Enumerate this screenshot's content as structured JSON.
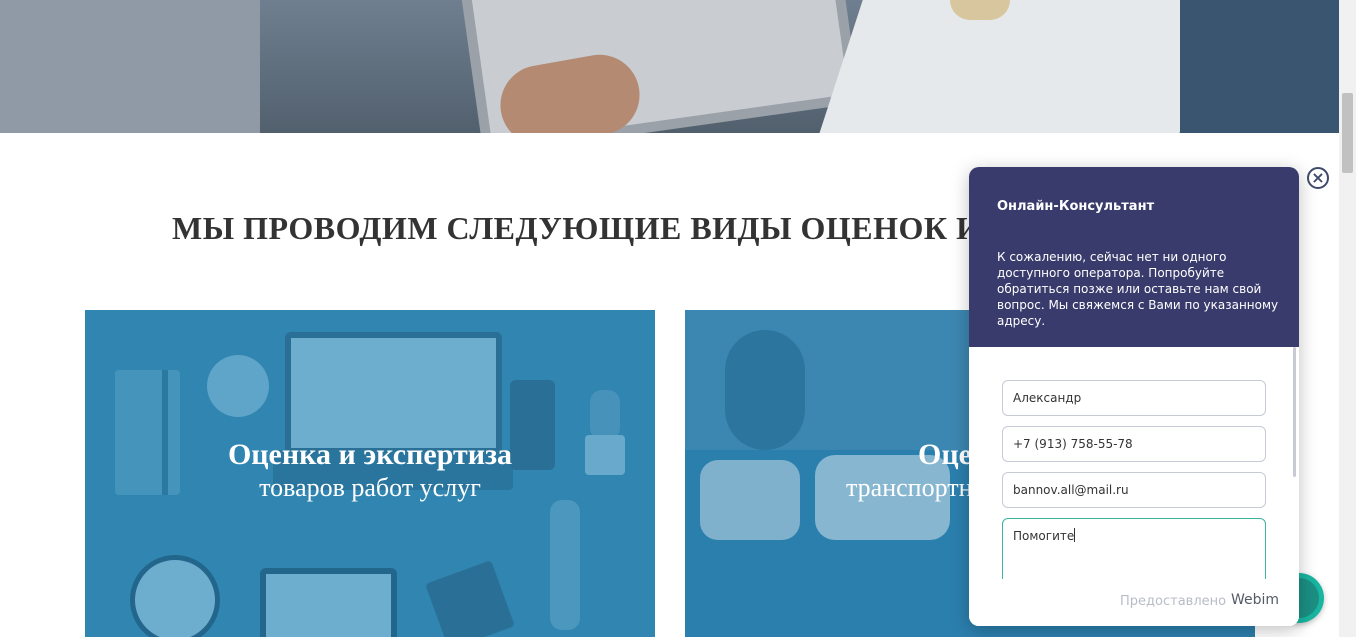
{
  "section": {
    "title": "МЫ ПРОВОДИМ СЛЕДУЮЩИЕ ВИДЫ ОЦЕНОК И"
  },
  "cards": [
    {
      "title": "Оценка и экспертиза",
      "subtitle": "товаров работ услуг"
    },
    {
      "title": "Оце",
      "subtitle": "транспортн"
    }
  ],
  "chat": {
    "title": "Онлайн-Консультант",
    "message": "К сожалению, сейчас нет ни одного доступного оператора. Попробуйте обратиться позже или оставьте нам свой вопрос. Мы свяжемся с Вами по указанному адресу.",
    "fields": {
      "name": "Александр",
      "phone": "+7 (913) 758-55-78",
      "email": "bannov.all@mail.ru",
      "question": "Помогите"
    },
    "powered_by": "Предоставлено",
    "brand": "Webim",
    "close_icon": "close-icon"
  },
  "colors": {
    "chat_header": "#383b6b",
    "card_overlay": "#3a88b0",
    "textarea_focus": "#3ab5a1",
    "fab": "#18b5a0"
  }
}
